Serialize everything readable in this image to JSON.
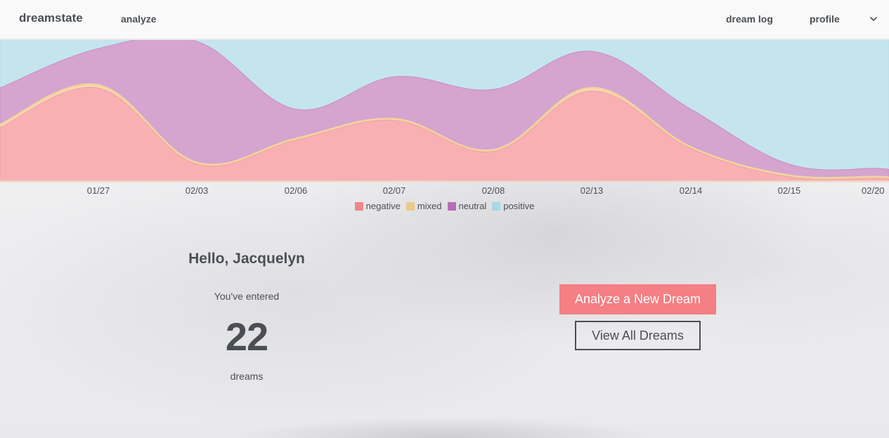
{
  "nav": {
    "brand": "dreamstate",
    "analyze": "analyze",
    "dream_log": "dream log",
    "profile": "profile"
  },
  "colors": {
    "negative": "#f6a6aa",
    "mixed": "#f2d9a6",
    "neutral": "#d2a0cd",
    "positive": "#c3e4ec",
    "primary_button": "#f47f84"
  },
  "chart_data": {
    "type": "area",
    "stacked": true,
    "categories": [
      "01/27",
      "02/03",
      "02/06",
      "02/07",
      "02/08",
      "02/13",
      "02/14",
      "02/15",
      "02/20"
    ],
    "ylim": [
      0,
      1
    ],
    "series": [
      {
        "name": "negative",
        "values": [
          0.66,
          0.12,
          0.29,
          0.43,
          0.21,
          0.64,
          0.23,
          0.03,
          0.02
        ]
      },
      {
        "name": "mixed",
        "values": [
          0.02,
          0.01,
          0.01,
          0.01,
          0.01,
          0.02,
          0.01,
          0.01,
          0.01
        ]
      },
      {
        "name": "neutral",
        "values": [
          0.26,
          0.86,
          0.21,
          0.3,
          0.43,
          0.26,
          0.27,
          0.08,
          0.06
        ]
      },
      {
        "name": "positive",
        "values": [
          0.06,
          0.01,
          0.49,
          0.26,
          0.35,
          0.08,
          0.49,
          0.88,
          0.91
        ]
      }
    ],
    "legend_position": "bottom"
  },
  "greeting": "Hello, Jacquelyn",
  "entered_label": "You've entered",
  "dream_count": "22",
  "dreams_label": "dreams",
  "buttons": {
    "analyze_new": "Analyze a New Dream",
    "view_all": "View All Dreams"
  }
}
